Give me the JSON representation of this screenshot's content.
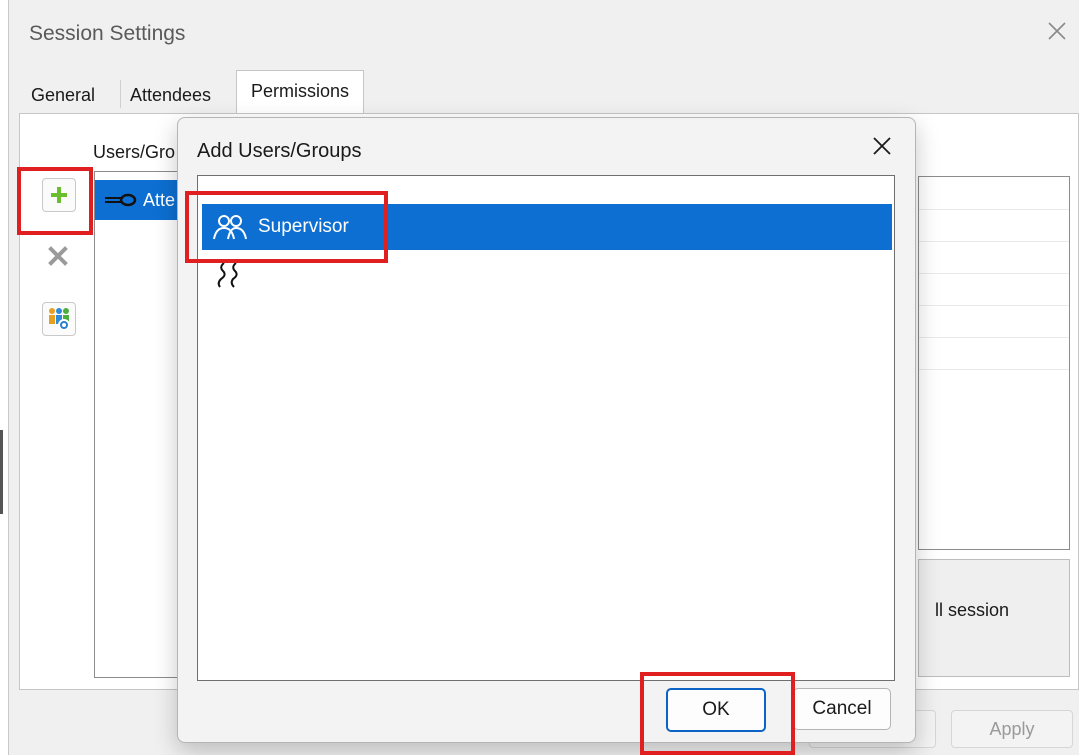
{
  "window": {
    "title": "Session Settings"
  },
  "tabs": [
    {
      "label": "General"
    },
    {
      "label": "Attendees"
    },
    {
      "label": "Permissions"
    }
  ],
  "permissions": {
    "users_label": "Users/Gro",
    "user_item": "Atte",
    "right_text": "ll session"
  },
  "bottom": {
    "apply": "Apply"
  },
  "dialog": {
    "title": "Add Users/Groups",
    "items": [
      {
        "label": "Supervisor",
        "icon": "group-icon",
        "selected": true
      },
      {
        "label": "",
        "icon": "group-outline-icon",
        "selected": false
      }
    ],
    "ok": "OK",
    "cancel": "Cancel"
  },
  "colors": {
    "selection": "#0d6fd1",
    "highlight": "#e02020",
    "plus": "#6bbf2e"
  }
}
